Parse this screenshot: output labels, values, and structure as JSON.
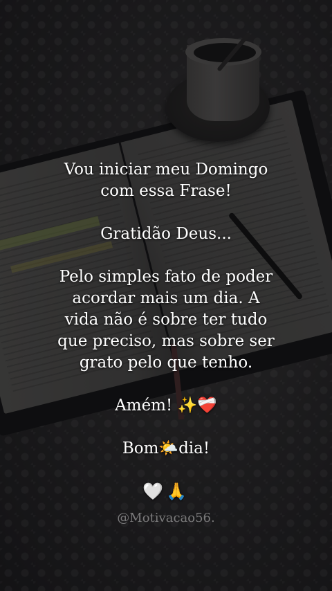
{
  "message": {
    "paragraphs": [
      [
        "Vou iniciar meu Domingo",
        "com essa Frase!"
      ],
      [
        "Gratidão Deus..."
      ],
      [
        "Pelo simples fato de poder",
        "acordar mais um dia. A",
        "vida não é sobre ter tudo",
        "que preciso, mas sobre ser",
        "grato pelo que tenho."
      ],
      [
        "Amém! ✨❤️‍🩹"
      ],
      [
        "Bom🌤️dia!"
      ]
    ],
    "emoji_line": "🤍🙏"
  },
  "watermark": "@Motivacao56.",
  "colors": {
    "text": "#ffffff",
    "watermark": "rgba(255,255,255,0.42)",
    "background": "#2a292a"
  }
}
